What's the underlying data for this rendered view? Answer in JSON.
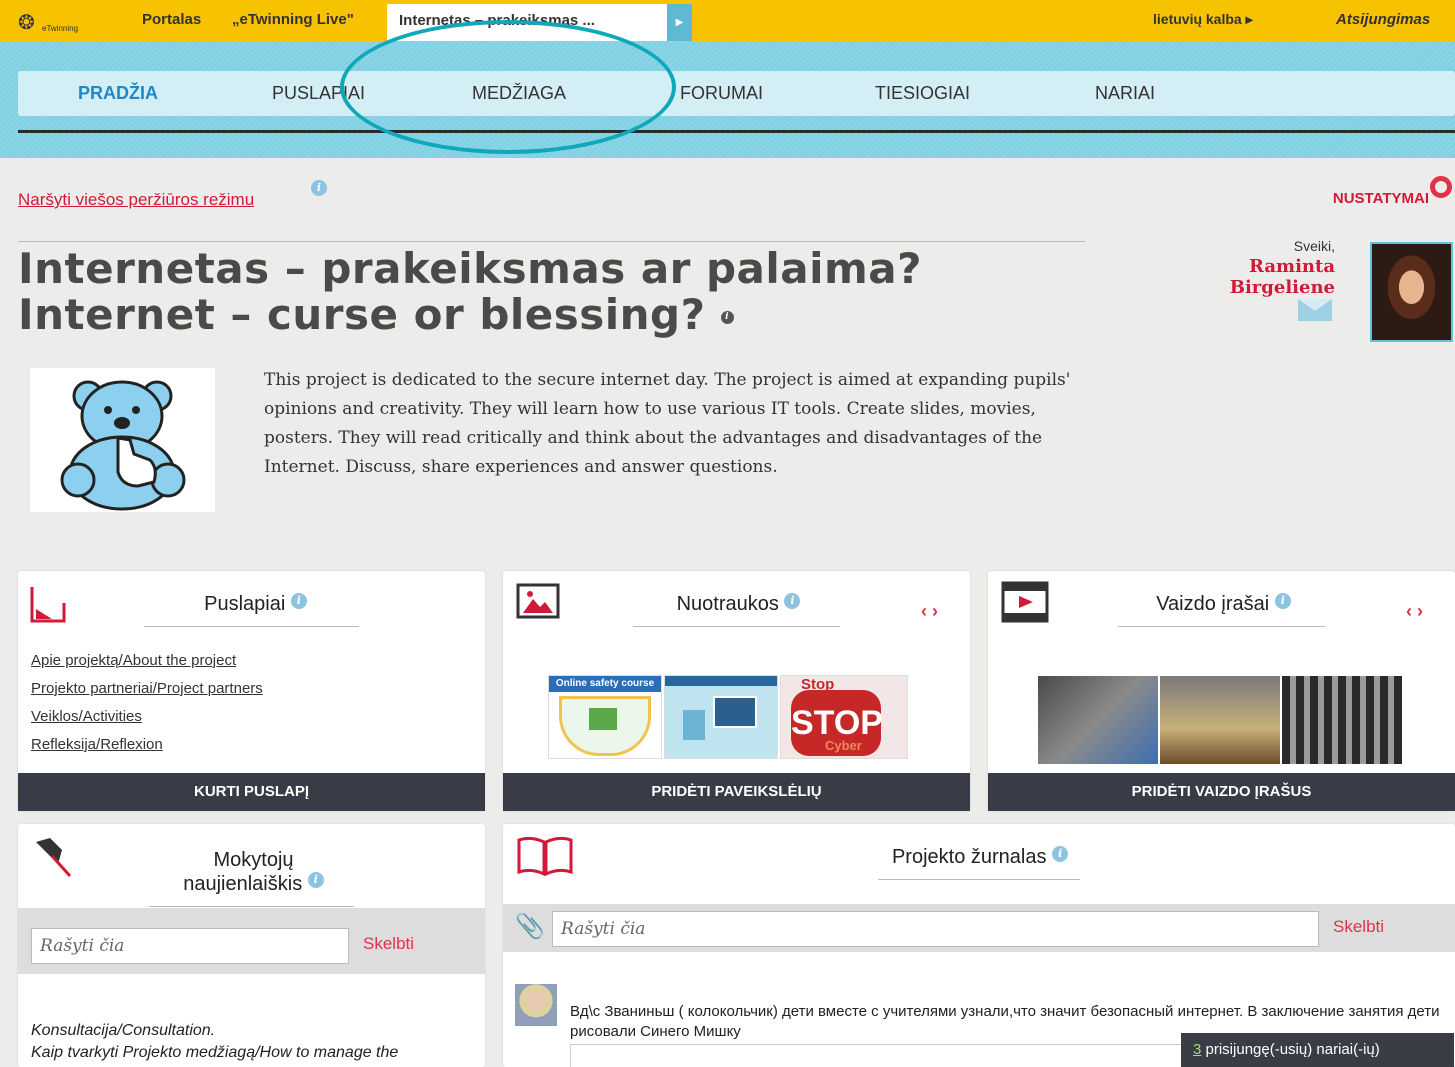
{
  "topbar": {
    "logo_text": "eTwinning",
    "portal": "Portalas",
    "live": "„eTwinning Live\"",
    "active_tab": "Internetas – prakeiksmas ...",
    "language": "lietuvių kalba ▸",
    "logout": "Atsijungimas"
  },
  "nav": {
    "items": [
      "PRADŽIA",
      "PUSLAPIAI",
      "MEDŽIAGA",
      "FORUMAI",
      "TIESIOGIAI",
      "NARIAI"
    ]
  },
  "subheader": {
    "public_view_link": "Naršyti viešos peržiūros režimu",
    "settings": "NUSTATYMAI"
  },
  "project": {
    "title": "Internetas – prakeiksmas ar palaima? Internet – curse or blessing?",
    "description": "This project is dedicated to the secure internet day. The project is aimed at expanding pupils' opinions and creativity. They will learn how to use various IT tools. Create slides, movies, posters. They will read critically and think about the advantages and disadvantages of the Internet. Discuss, share experiences and answer questions."
  },
  "user": {
    "greeting": "Sveiki,",
    "name": "Raminta Birgeliene"
  },
  "cards": {
    "pages": {
      "title": "Puslapiai",
      "links": [
        "Apie projektą/About the project",
        "Projekto partneriai/Project partners",
        "Veiklos/Activities",
        "Refleksija/Reflexion"
      ],
      "footer": "KURTI PUSLAPĮ"
    },
    "photos": {
      "title": "Nuotraukos",
      "footer": "PRIDĖTI PAVEIKSLĖLIŲ",
      "thumb_labels": [
        "Online safety course",
        "",
        "Stop",
        "STOP",
        "Cyber"
      ]
    },
    "videos": {
      "title": "Vaizdo įrašai",
      "footer": "PRIDĖTI VAIZDO ĮRAŠUS"
    },
    "newsletter": {
      "title_line1": "Mokytojų",
      "title_line2": "naujienlaiškis",
      "placeholder": "Rašyti čia",
      "post_button": "Skelbti",
      "items": [
        "Konsultacija/Consultation.",
        "Kaip tvarkyti Projekto medžiagą/How to manage the"
      ]
    },
    "journal": {
      "title": "Projekto žurnalas",
      "placeholder": "Rašyti čia",
      "post_button": "Skelbti",
      "entry_text": "Вд\\с Званиньш ( колокольчик) дети вместе с учителями узнали,что значит безопасный интернет. В заключение занятия дети рисовали Синего Мишку"
    }
  },
  "online": {
    "count": "3",
    "label": " prisijungę(-usių) nariai(-ių)"
  },
  "colors": {
    "topbar": "#f7c200",
    "nav_band": "#7fd0e2",
    "accent_red": "#d01a38",
    "footer_dark": "#393b47",
    "highlight_circle": "#0fa8b8"
  }
}
